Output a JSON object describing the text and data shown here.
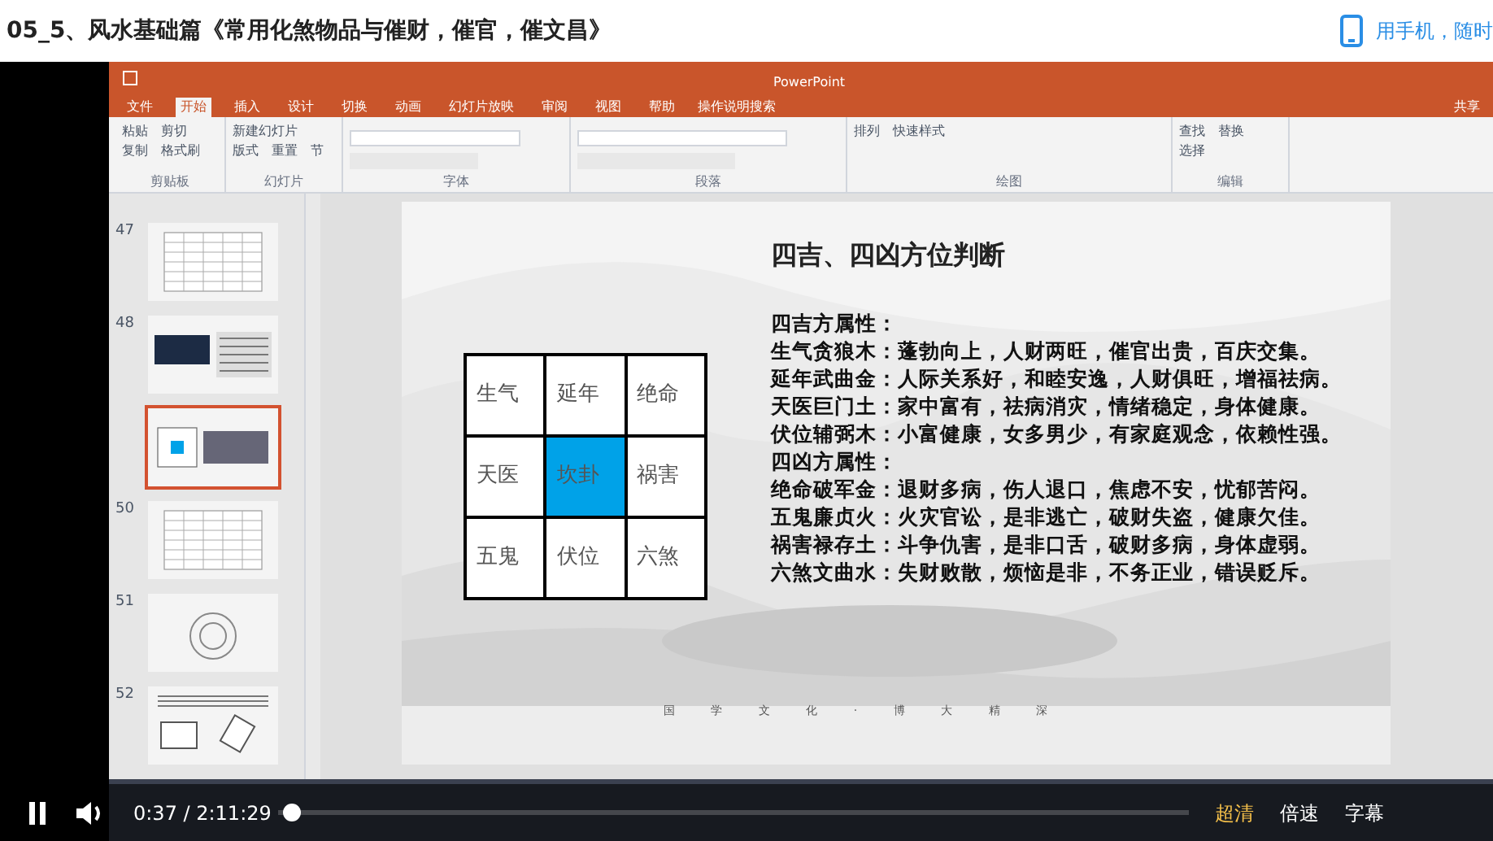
{
  "page_title": "05_5、风水基础篇《常用化煞物品与催财，催官，催文昌》",
  "mobile_link": "用手机，随时",
  "ppt": {
    "app_title": "PowerPoint",
    "tabs": [
      {
        "label": "文件",
        "selected": false
      },
      {
        "label": "开始",
        "selected": true
      },
      {
        "label": "插入",
        "selected": false
      },
      {
        "label": "设计",
        "selected": false
      },
      {
        "label": "切换",
        "selected": false
      },
      {
        "label": "动画",
        "selected": false
      },
      {
        "label": "幻灯片放映",
        "selected": false
      },
      {
        "label": "审阅",
        "selected": false
      },
      {
        "label": "视图",
        "selected": false
      },
      {
        "label": "帮助",
        "selected": false
      }
    ],
    "search_hint": "操作说明搜索",
    "share": "共享",
    "ribbon_groups": [
      {
        "label": "剪贴板",
        "items": [
          "粘贴",
          "剪切",
          "复制",
          "格式刷"
        ]
      },
      {
        "label": "幻灯片",
        "items": [
          "新建幻灯片",
          "版式",
          "重置",
          "节"
        ]
      },
      {
        "label": "字体"
      },
      {
        "label": "段落"
      },
      {
        "label": "绘图",
        "items": [
          "排列",
          "快速样式"
        ]
      },
      {
        "label": "编辑",
        "items": [
          "查找",
          "替换",
          "选择"
        ]
      }
    ],
    "thumbnails": [
      {
        "number": "47",
        "selected": false,
        "kind": "table"
      },
      {
        "number": "48",
        "selected": false
      },
      {
        "selected": true,
        "kind": "grid"
      },
      {
        "number": "50",
        "selected": false,
        "kind": "table"
      },
      {
        "number": "51",
        "selected": false,
        "kind": "circle"
      },
      {
        "number": "52",
        "selected": false,
        "kind": "figures"
      }
    ],
    "slide": {
      "title": "四吉、四凶方位判断",
      "grid": [
        {
          "label": "生气",
          "highlighted": false
        },
        {
          "label": "延年",
          "highlighted": false
        },
        {
          "label": "绝命",
          "highlighted": false
        },
        {
          "label": "天医",
          "highlighted": false
        },
        {
          "label": "坎卦",
          "highlighted": true
        },
        {
          "label": "祸害",
          "highlighted": false
        },
        {
          "label": "五鬼",
          "highlighted": false
        },
        {
          "label": "伏位",
          "highlighted": false
        },
        {
          "label": "六煞",
          "highlighted": false
        }
      ],
      "lines": [
        "四吉方属性：",
        "生气贪狼木：蓬勃向上，人财两旺，催官出贵，百庆交集。",
        "延年武曲金：人际关系好，和睦安逸，人财俱旺，增福祛病。",
        "天医巨门土：家中富有，祛病消灾，情绪稳定，身体健康。",
        "伏位辅弼木：小富健康，女多男少，有家庭观念，依赖性强。",
        "四凶方属性：",
        "绝命破军金：退财多病，伤人退口，焦虑不安，忧郁苦闷。",
        "五鬼廉贞火：火灾官讼，是非逃亡，破财失盗，健康欠佳。",
        "祸害禄存土：斗争仇害，是非口舌，破财多病，身体虚弱。",
        "六煞文曲水：失财败散，烦恼是非，不务正业，错误贬斥。"
      ],
      "footer": "国 学 文 化 · 博 大 精 深"
    }
  },
  "player": {
    "playing": true,
    "time": "0:37 / 2:11:29",
    "progress": {
      "level": 0.005
    },
    "quality": "超清",
    "speed": "倍速",
    "subtitles": "字幕"
  }
}
